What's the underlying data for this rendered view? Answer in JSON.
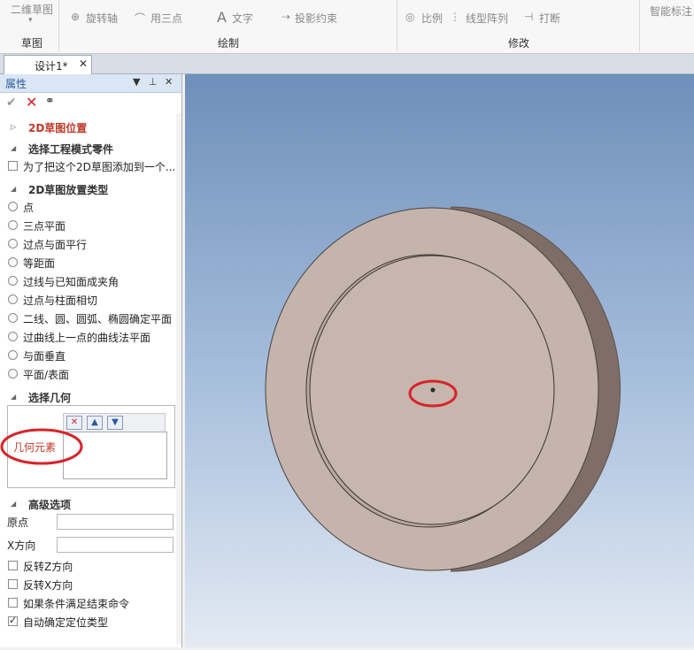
{
  "ribbon": {
    "groups": [
      {
        "items": [
          "二维草图"
        ],
        "label": "草图"
      },
      {
        "items": [
          "旋转轴",
          "用三点"
        ],
        "label": "绘制"
      },
      {
        "items": [
          "文字",
          "投影约束"
        ],
        "label": ""
      },
      {
        "items": [
          "比例",
          "线型阵列",
          "打断"
        ],
        "label": "修改"
      },
      {
        "items": [
          "智能标注"
        ],
        "label": ""
      }
    ]
  },
  "tabs": [
    {
      "label": "设计1*"
    }
  ],
  "panel": {
    "title": "属性",
    "section_position": "2D草图位置",
    "section_select_part": "选择工程模式零件",
    "chk_add_sketch": "为了把这个2D草图添加到一个...",
    "section_placement": "2D草图放置类型",
    "options": [
      "点",
      "三点平面",
      "过点与面平行",
      "等距面",
      "过线与已知面成夹角",
      "过点与柱面相切",
      "二线、圆、圆弧、椭圆确定平面",
      "过曲线上一点的曲线法平面",
      "与面垂直",
      "平面/表面"
    ],
    "section_geometry": "选择几何",
    "geometry_label": "几何元素",
    "section_advanced": "高级选项",
    "origin_label": "原点",
    "xdir_label": "X方向",
    "origin_value": "",
    "xdir_value": "",
    "checks": [
      {
        "label": "反转Z方向",
        "checked": false
      },
      {
        "label": "反转X方向",
        "checked": false
      },
      {
        "label": "如果条件满足结束命令",
        "checked": false
      },
      {
        "label": "自动确定定位类型",
        "checked": true
      }
    ]
  },
  "colors": {
    "accent": "#2c5aa0",
    "annotation": "#d9232a",
    "part": "#c4b4ab",
    "part_edge": "#8a7a72"
  }
}
